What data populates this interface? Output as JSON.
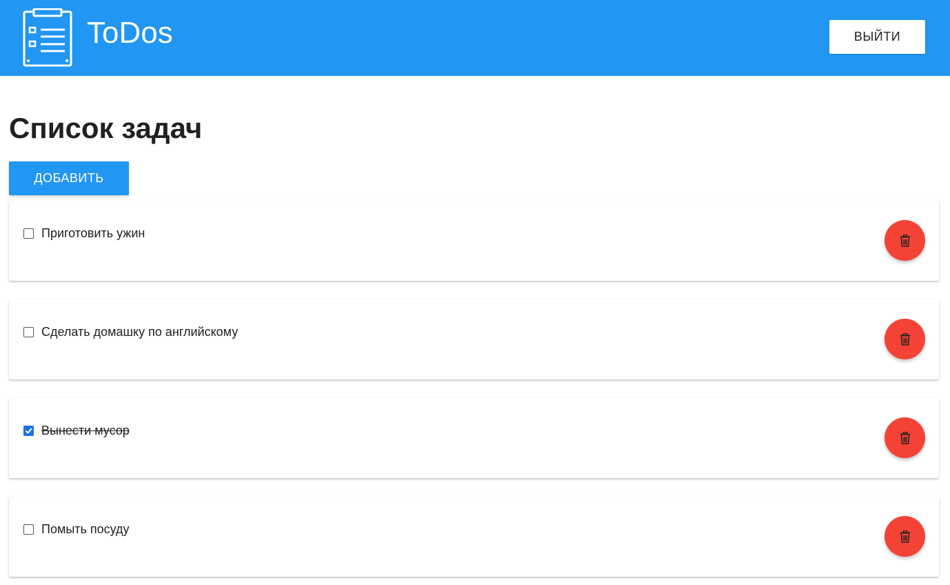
{
  "header": {
    "title": "ToDos",
    "logout_label": "ВЫЙТИ",
    "background": "#2196f3"
  },
  "main": {
    "title": "Список задач",
    "add_label": "ДОБАВИТЬ"
  },
  "todos": [
    {
      "text": "Приготовить ужин",
      "done": false
    },
    {
      "text": "Сделать домашку по английскому",
      "done": false
    },
    {
      "text": "Вынести мусор",
      "done": true
    },
    {
      "text": "Помыть посуду",
      "done": false
    }
  ],
  "icons": {
    "logo": "clipboard-list-icon",
    "delete": "trash-icon",
    "check": "checkmark-icon"
  },
  "colors": {
    "primary": "#2196f3",
    "danger": "#f44336",
    "checkbox_checked": "#1a73e8"
  }
}
